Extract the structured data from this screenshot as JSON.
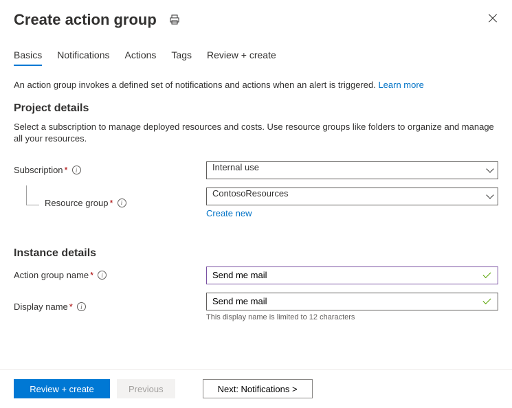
{
  "header": {
    "title": "Create action group"
  },
  "tabs": [
    {
      "label": "Basics",
      "active": true
    },
    {
      "label": "Notifications",
      "active": false
    },
    {
      "label": "Actions",
      "active": false
    },
    {
      "label": "Tags",
      "active": false
    },
    {
      "label": "Review + create",
      "active": false
    }
  ],
  "intro": {
    "text": "An action group invokes a defined set of notifications and actions when an alert is triggered. ",
    "link": "Learn more"
  },
  "projectDetails": {
    "heading": "Project details",
    "desc": "Select a subscription to manage deployed resources and costs. Use resource groups like folders to organize and manage all your resources.",
    "subscription": {
      "label": "Subscription",
      "value": "Internal use"
    },
    "resourceGroup": {
      "label": "Resource group",
      "value": "ContosoResources",
      "createNew": "Create new"
    }
  },
  "instanceDetails": {
    "heading": "Instance details",
    "actionGroupName": {
      "label": "Action group name",
      "value": "Send me mail"
    },
    "displayName": {
      "label": "Display name",
      "value": "Send me mail",
      "hint": "This display name is limited to 12 characters"
    }
  },
  "footer": {
    "primary": "Review + create",
    "previous": "Previous",
    "next": "Next: Notifications >"
  }
}
